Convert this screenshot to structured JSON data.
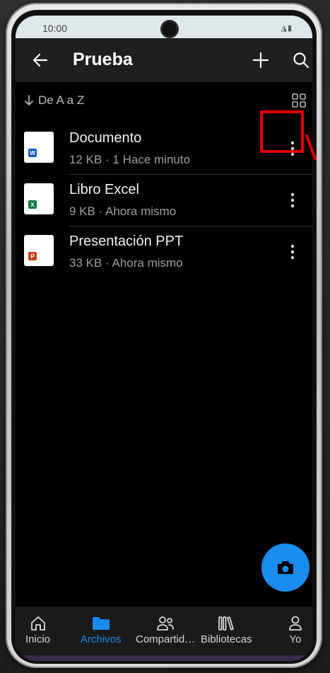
{
  "status_bar": {
    "time": "10:00",
    "icons": "◮▮"
  },
  "app_bar": {
    "title": "Prueba",
    "back_icon": "arrow-left-icon",
    "add_icon": "plus-icon",
    "search_icon": "search-icon"
  },
  "sort": {
    "label": "De A a Z",
    "icon": "arrow-down-icon",
    "view_icon": "grid-view-icon"
  },
  "files": [
    {
      "name": "Documento",
      "meta": "12 KB · 1 Hace minuto",
      "type": "word",
      "badge": "W",
      "color": "#185abd"
    },
    {
      "name": "Libro Excel",
      "meta": "9 KB · Ahora mismo",
      "type": "excel",
      "badge": "X",
      "color": "#107c41"
    },
    {
      "name": "Presentación PPT",
      "meta": "33 KB · Ahora mismo",
      "type": "powerpoint",
      "badge": "P",
      "color": "#c43e1c"
    }
  ],
  "fab": {
    "icon": "camera-icon"
  },
  "bottom_nav": {
    "items": [
      {
        "label": "Inicio",
        "icon": "home-icon",
        "active": false
      },
      {
        "label": "Archivos",
        "icon": "folder-icon",
        "active": true
      },
      {
        "label": "Compartid…",
        "icon": "people-icon",
        "active": false
      },
      {
        "label": "Bibliotecas",
        "icon": "library-icon",
        "active": false
      },
      {
        "label": "Yo",
        "icon": "person-icon",
        "active": false
      }
    ]
  },
  "colors": {
    "accent": "#1a8cf0",
    "highlight": "#e00000",
    "background": "#000000"
  }
}
